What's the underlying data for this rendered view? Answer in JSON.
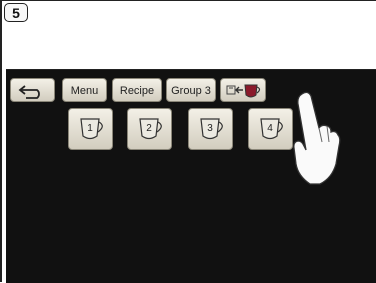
{
  "step": {
    "number": "5"
  },
  "menu_bar": {
    "back_icon": "return-arrow-icon",
    "menu_label": "Menu",
    "recipe_label": "Recipe",
    "group_label": "Group 3",
    "swap_icon": "cup-to-cup-swap-icon"
  },
  "cups": [
    {
      "label": "1"
    },
    {
      "label": "2"
    },
    {
      "label": "3"
    },
    {
      "label": "4"
    }
  ],
  "colors": {
    "screen_bg": "#111111",
    "button_face": "#e6e2d6",
    "cup_red": "#8b1a2b"
  }
}
